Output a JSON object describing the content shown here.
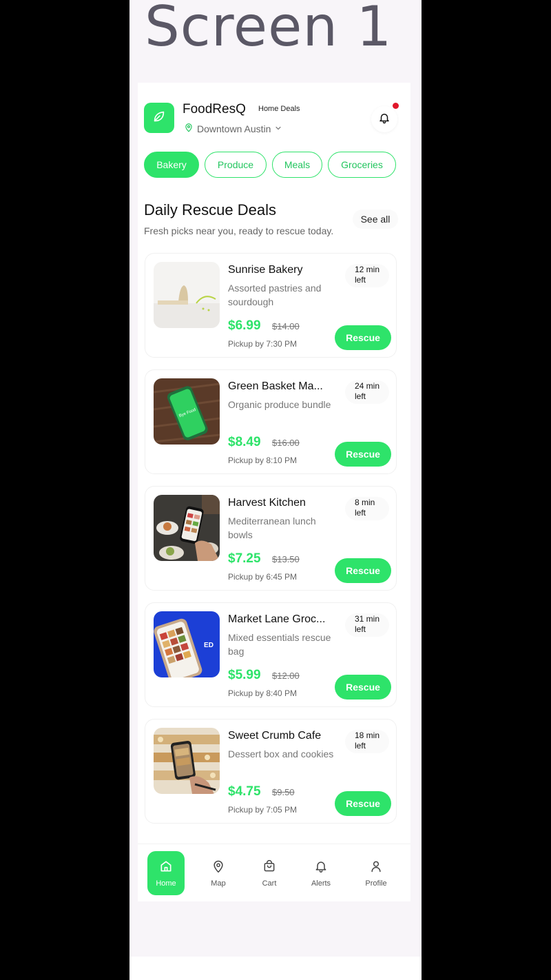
{
  "screen_label": "Screen 1",
  "header": {
    "brand": "FoodResQ",
    "subtitle": "Home Deals",
    "location": "Downtown Austin"
  },
  "categories": [
    "Bakery",
    "Produce",
    "Meals",
    "Groceries"
  ],
  "section": {
    "title": "Daily Rescue Deals",
    "subtitle": "Fresh picks near you, ready to rescue today.",
    "see_all": "See all"
  },
  "deals": [
    {
      "name": "Sunrise Bakery",
      "desc": "Assorted pastries and sourdough",
      "time_line1": "12 min",
      "time_line2": "left",
      "price": "$6.99",
      "old_price": "$14.00",
      "pickup": "Pickup by 7:30 PM",
      "button": "Rescue"
    },
    {
      "name": "Green Basket Ma...",
      "desc": "Organic produce bundle",
      "time_line1": "24 min",
      "time_line2": "left",
      "price": "$8.49",
      "old_price": "$16.00",
      "pickup": "Pickup by 8:10 PM",
      "button": "Rescue"
    },
    {
      "name": "Harvest Kitchen",
      "desc": "Mediterranean lunch bowls",
      "time_line1": "8 min",
      "time_line2": "left",
      "price": "$7.25",
      "old_price": "$13.50",
      "pickup": "Pickup by 6:45 PM",
      "button": "Rescue"
    },
    {
      "name": "Market Lane Groc...",
      "desc": "Mixed essentials rescue bag",
      "time_line1": "31 min",
      "time_line2": "left",
      "price": "$5.99",
      "old_price": "$12.00",
      "pickup": "Pickup by 8:40 PM",
      "button": "Rescue"
    },
    {
      "name": "Sweet Crumb Cafe",
      "desc": "Dessert box and cookies",
      "time_line1": "18 min",
      "time_line2": "left",
      "price": "$4.75",
      "old_price": "$9.50",
      "pickup": "Pickup by 7:05 PM",
      "button": "Rescue"
    }
  ],
  "thumb_text": {
    "phone_screen": "Bye Food",
    "promo": "ED"
  },
  "nav": [
    {
      "label": "Home",
      "icon": "home-icon"
    },
    {
      "label": "Map",
      "icon": "map-pin-icon"
    },
    {
      "label": "Cart",
      "icon": "bag-icon"
    },
    {
      "label": "Alerts",
      "icon": "bell-icon"
    },
    {
      "label": "Profile",
      "icon": "user-icon"
    }
  ],
  "colors": {
    "accent": "#2ee36a",
    "notification": "#e0172a"
  }
}
